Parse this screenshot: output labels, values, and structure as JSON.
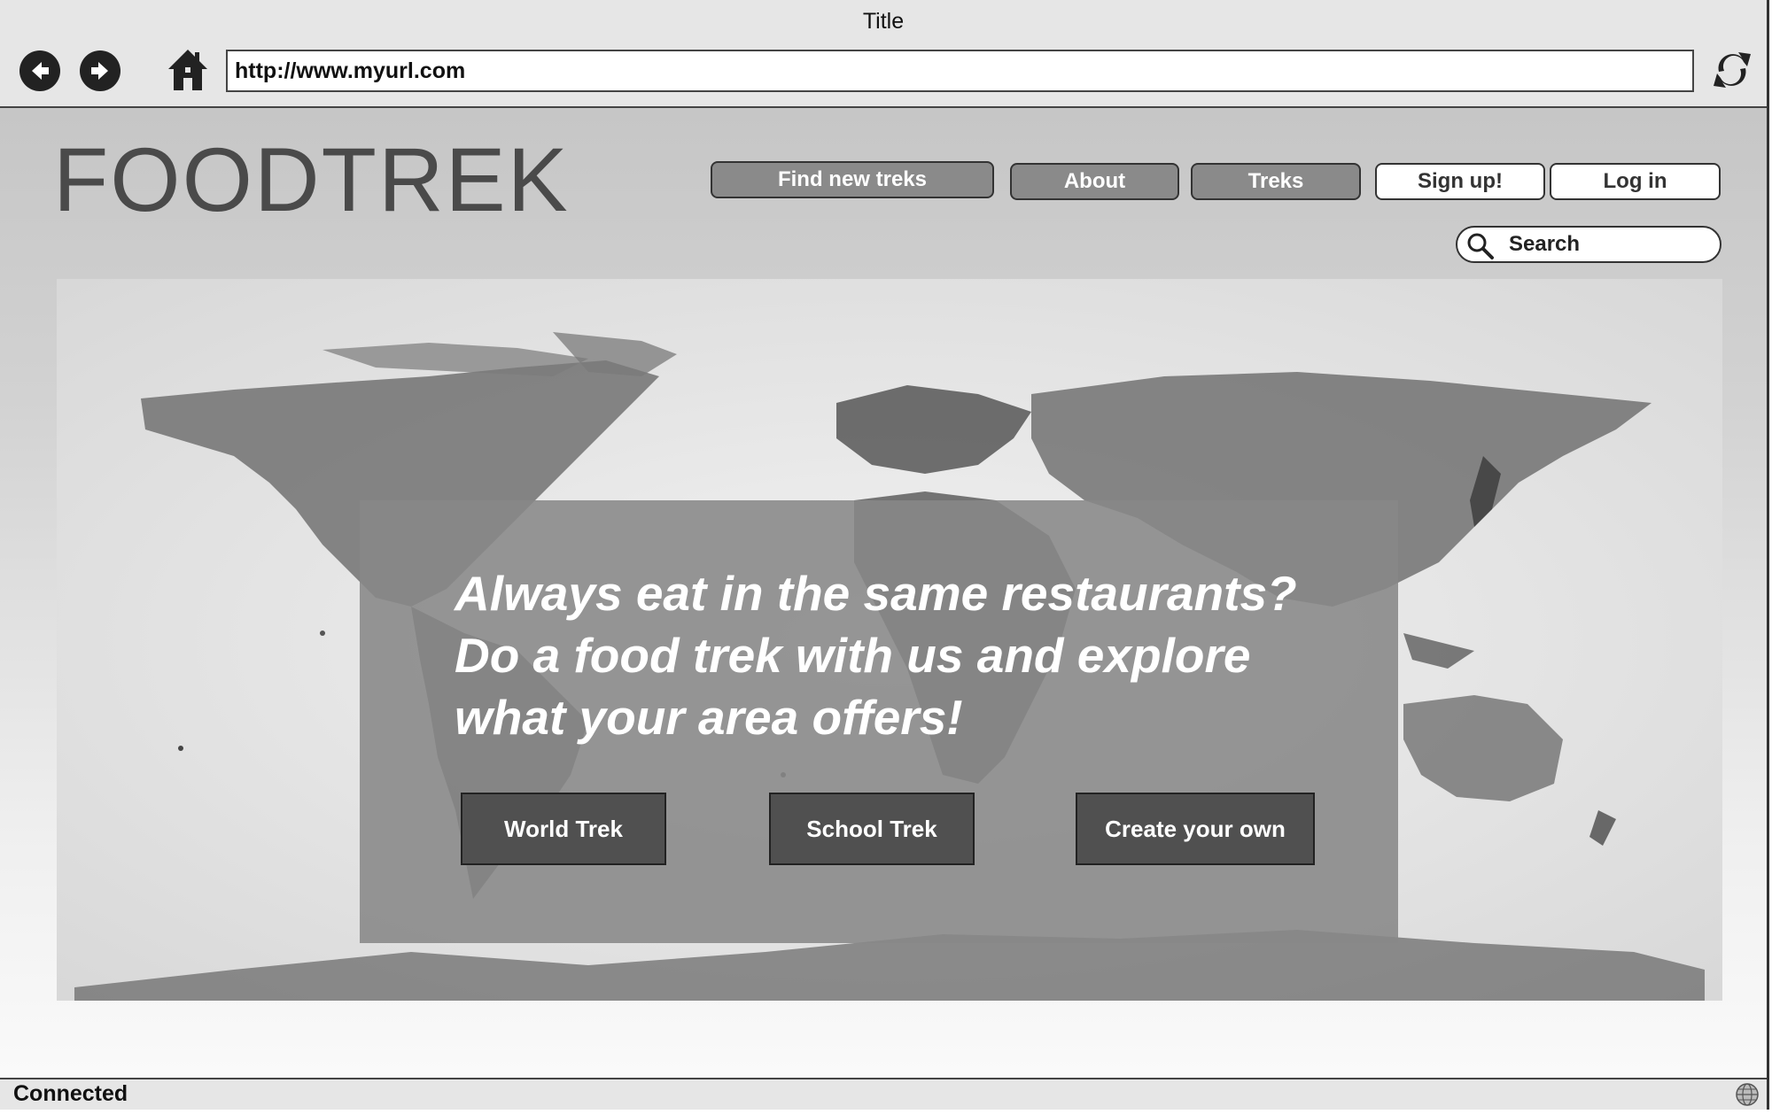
{
  "browser": {
    "title": "Title",
    "url": "http://www.myurl.com",
    "icons": {
      "back": "arrow-left-circle",
      "forward": "arrow-right-circle",
      "home": "house",
      "refresh": "circular-arrows",
      "status": "globe"
    }
  },
  "site": {
    "logo": "FOODTREK",
    "nav": {
      "find": "Find new treks",
      "about": "About",
      "treks": "Treks",
      "signup": "Sign up!",
      "login": "Log in"
    },
    "search": {
      "placeholder": "Search",
      "icon": "magnifier"
    }
  },
  "hero": {
    "background": "world-map",
    "tagline_1": "Always eat in the same restaurants?",
    "tagline_2": "Do a food trek with us and explore",
    "tagline_3": "what your area offers!",
    "buttons": {
      "world": "World Trek",
      "school": "School Trek",
      "create": "Create your own"
    }
  },
  "status": {
    "text": "Connected"
  },
  "colors": {
    "chrome": "#e6e6e6",
    "nav_dark": "#8a8a8a",
    "cta": "#505050",
    "overlay": "#878787",
    "logo": "#4a4a4a"
  }
}
